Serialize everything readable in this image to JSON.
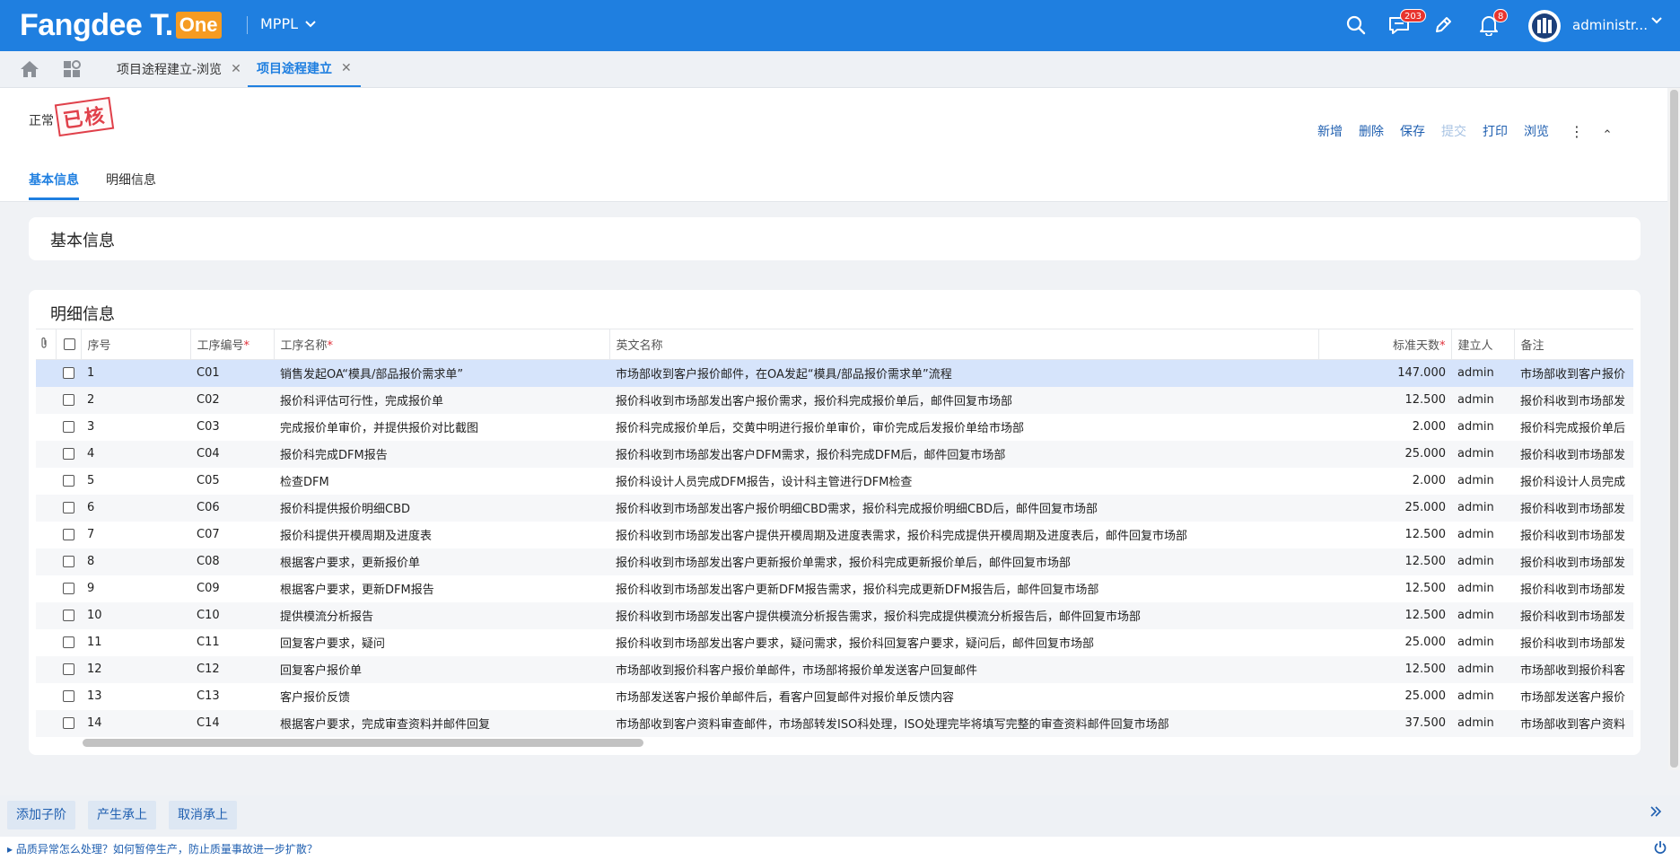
{
  "brand": {
    "name": "Fangdee T.",
    "badge": "One"
  },
  "app_selector": "MPPL",
  "notifications": {
    "messages_count": "203",
    "alerts_count": "8"
  },
  "user": {
    "name": "administr..."
  },
  "tabs": [
    {
      "label": "项目途程建立-浏览"
    },
    {
      "label": "项目途程建立"
    }
  ],
  "record": {
    "status": "正常",
    "stamp": "已核"
  },
  "toolbar": {
    "new": "新增",
    "delete": "删除",
    "save": "保存",
    "submit": "提交",
    "print": "打印",
    "browse": "浏览"
  },
  "subtabs": [
    {
      "label": "基本信息"
    },
    {
      "label": "明细信息"
    }
  ],
  "basic_section": {
    "title": "基本信息"
  },
  "detail_section": {
    "title": "明细信息"
  },
  "table": {
    "columns": {
      "seq": "序号",
      "code": "工序编号",
      "name": "工序名称",
      "en_name": "英文名称",
      "days": "标准天数",
      "creator": "建立人",
      "remark": "备注"
    },
    "required_mark": "*",
    "rows": [
      {
        "seq": "1",
        "code": "C01",
        "name": "销售发起OA“模具/部品报价需求单”",
        "en_name": "市场部收到客户报价邮件，在OA发起“模具/部品报价需求单”流程",
        "days": "147.000",
        "creator": "admin",
        "remark": "市场部收到客户报价"
      },
      {
        "seq": "2",
        "code": "C02",
        "name": "报价科评估可行性，完成报价单",
        "en_name": "报价科收到市场部发出客户报价需求，报价科完成报价单后，邮件回复市场部",
        "days": "12.500",
        "creator": "admin",
        "remark": "报价科收到市场部发"
      },
      {
        "seq": "3",
        "code": "C03",
        "name": "完成报价单审价，并提供报价对比截图",
        "en_name": "报价科完成报价单后，交黄中明进行报价单审价，审价完成后发报价单给市场部",
        "days": "2.000",
        "creator": "admin",
        "remark": "报价科完成报价单后"
      },
      {
        "seq": "4",
        "code": "C04",
        "name": "报价科完成DFM报告",
        "en_name": "报价科收到市场部发出客户DFM需求，报价科完成DFM后，邮件回复市场部",
        "days": "25.000",
        "creator": "admin",
        "remark": "报价科收到市场部发"
      },
      {
        "seq": "5",
        "code": "C05",
        "name": "检查DFM",
        "en_name": "报价科设计人员完成DFM报告，设计科主管进行DFM检查",
        "days": "2.000",
        "creator": "admin",
        "remark": "报价科设计人员完成"
      },
      {
        "seq": "6",
        "code": "C06",
        "name": "报价科提供报价明细CBD",
        "en_name": "报价科收到市场部发出客户报价明细CBD需求，报价科完成报价明细CBD后，邮件回复市场部",
        "days": "25.000",
        "creator": "admin",
        "remark": "报价科收到市场部发"
      },
      {
        "seq": "7",
        "code": "C07",
        "name": "报价科提供开模周期及进度表",
        "en_name": "报价科收到市场部发出客户提供开模周期及进度表需求，报价科完成提供开模周期及进度表后，邮件回复市场部",
        "days": "12.500",
        "creator": "admin",
        "remark": "报价科收到市场部发"
      },
      {
        "seq": "8",
        "code": "C08",
        "name": "根据客户要求，更新报价单",
        "en_name": "报价科收到市场部发出客户更新报价单需求，报价科完成更新报价单后，邮件回复市场部",
        "days": "12.500",
        "creator": "admin",
        "remark": "报价科收到市场部发"
      },
      {
        "seq": "9",
        "code": "C09",
        "name": "根据客户要求，更新DFM报告",
        "en_name": "报价科收到市场部发出客户更新DFM报告需求，报价科完成更新DFM报告后，邮件回复市场部",
        "days": "12.500",
        "creator": "admin",
        "remark": "报价科收到市场部发"
      },
      {
        "seq": "10",
        "code": "C10",
        "name": "提供模流分析报告",
        "en_name": "报价科收到市场部发出客户提供模流分析报告需求，报价科完成提供模流分析报告后，邮件回复市场部",
        "days": "12.500",
        "creator": "admin",
        "remark": "报价科收到市场部发"
      },
      {
        "seq": "11",
        "code": "C11",
        "name": "回复客户要求，疑问",
        "en_name": "报价科收到市场部发出客户要求，疑问需求，报价科回复客户要求，疑问后，邮件回复市场部",
        "days": "25.000",
        "creator": "admin",
        "remark": "报价科收到市场部发"
      },
      {
        "seq": "12",
        "code": "C12",
        "name": "回复客户报价单",
        "en_name": "市场部收到报价科客户报价单邮件，市场部将报价单发送客户回复邮件",
        "days": "12.500",
        "creator": "admin",
        "remark": "市场部收到报价科客"
      },
      {
        "seq": "13",
        "code": "C13",
        "name": "客户报价反馈",
        "en_name": "市场部发送客户报价单邮件后，看客户回复邮件对报价单反馈内容",
        "days": "25.000",
        "creator": "admin",
        "remark": "市场部发送客户报价"
      },
      {
        "seq": "14",
        "code": "C14",
        "name": "根据客户要求，完成审查资料并邮件回复",
        "en_name": "市场部收到客户资料审查邮件，市场部转发ISO科处理，ISO处理完毕将填写完整的审查资料邮件回复市场部",
        "days": "37.500",
        "creator": "admin",
        "remark": "市场部收到客户资料"
      }
    ]
  },
  "bottom_buttons": {
    "add_child": "添加子阶",
    "produce": "产生承上",
    "cancel": "取消承上"
  },
  "footer": {
    "tip": "品质异常怎么处理？如何暂停生产，防止质量事故进一步扩散？"
  },
  "colors": {
    "brand_blue": "#1f7fe0",
    "badge_orange": "#f59b22",
    "stamp_red": "#e0404a",
    "required_red": "#e0303a"
  }
}
